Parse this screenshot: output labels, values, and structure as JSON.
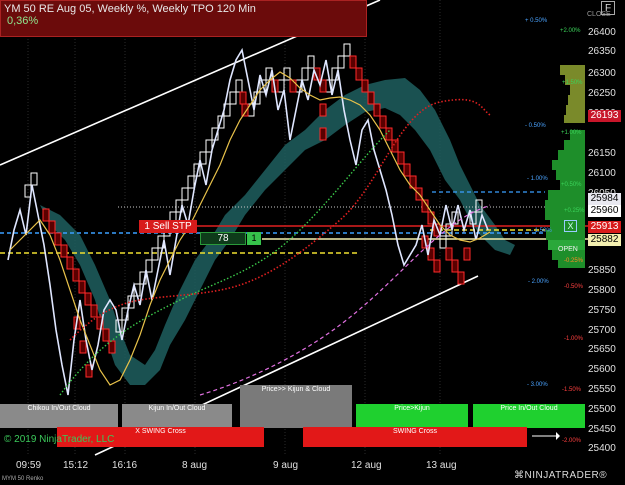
{
  "title": {
    "line1": "YM 50 RE Aug 05, Weekly %, Weekly TPO 120 Min",
    "line2": "0,36%"
  },
  "corner_badge": "F",
  "close_label": "CLOSE",
  "price_axis": [
    "26400",
    "26350",
    "26300",
    "26250",
    "26200",
    "26150",
    "26100",
    "26050",
    "26000",
    "25950",
    "25900",
    "25850",
    "25800",
    "25750",
    "25700",
    "25650",
    "25600",
    "25550",
    "25500",
    "25450",
    "25400"
  ],
  "price_badges": [
    {
      "value": "26193",
      "bg": "#c8162a",
      "fg": "#ffffff"
    },
    {
      "value": "25984",
      "bg": "#e8e8f0",
      "fg": "#000000"
    },
    {
      "value": "25960",
      "bg": "#ffffff",
      "fg": "#000000"
    },
    {
      "value": "25913",
      "bg": "#d81b1b",
      "fg": "#ffffff"
    },
    {
      "value": "25882",
      "bg": "#f4f0b0",
      "fg": "#000000"
    }
  ],
  "order": {
    "sell_stp": "1  Sell STP",
    "qty": "78",
    "qty_btn": "1",
    "close_btn": "X"
  },
  "open_label": "OPEN",
  "percent_labels": [
    {
      "text": "+ 0.50%",
      "color": "#4aa3ff"
    },
    {
      "text": "+2.00%",
      "color": "#3bd35a"
    },
    {
      "text": "+1.50%",
      "color": "#3bd35a"
    },
    {
      "text": "- 0.50%",
      "color": "#4aa3ff"
    },
    {
      "text": "+1.00%",
      "color": "#3bd35a"
    },
    {
      "text": "- 1.00%",
      "color": "#4aa3ff"
    },
    {
      "text": "+0.50%",
      "color": "#3bd35a"
    },
    {
      "text": "- 1.50%",
      "color": "#4aa3ff"
    },
    {
      "text": "+0.25%",
      "color": "#3bd35a"
    },
    {
      "text": "-0.25%",
      "color": "#ff8a2a"
    },
    {
      "text": "- 2.00%",
      "color": "#4aa3ff"
    },
    {
      "text": "-0.50%",
      "color": "#ff4040"
    },
    {
      "text": "-1.00%",
      "color": "#ff4040"
    },
    {
      "text": "- 3.00%",
      "color": "#4aa3ff"
    },
    {
      "text": "-1.50%",
      "color": "#ff4040"
    },
    {
      "text": "-2.00%",
      "color": "#ff4040"
    }
  ],
  "cloud_labels": [
    {
      "text": "Chikou In/Out Cloud",
      "bg": "#8a8a8a"
    },
    {
      "text": "Kijun In/Out Cloud",
      "bg": "#8a8a8a"
    },
    {
      "text": "Price>> Kijun & Cloud",
      "bg": "#7a7a7a"
    },
    {
      "text": "Price>Kijun",
      "bg": "#1fd02f"
    },
    {
      "text": "Price In/Out Cloud",
      "bg": "#1fd02f"
    },
    {
      "text": "X SWING Cross",
      "bg": "#e21818"
    },
    {
      "text": "SWING Cross",
      "bg": "#e21818"
    }
  ],
  "copyright": "© 2019 NinjaTrader, LLC",
  "x_axis": [
    "09:59",
    "15:12",
    "16:16",
    "8 aug",
    "9 aug",
    "12 aug",
    "13 aug"
  ],
  "instrument": "MYM 50 Renko",
  "logo": "⌘NINJATRADER®"
}
